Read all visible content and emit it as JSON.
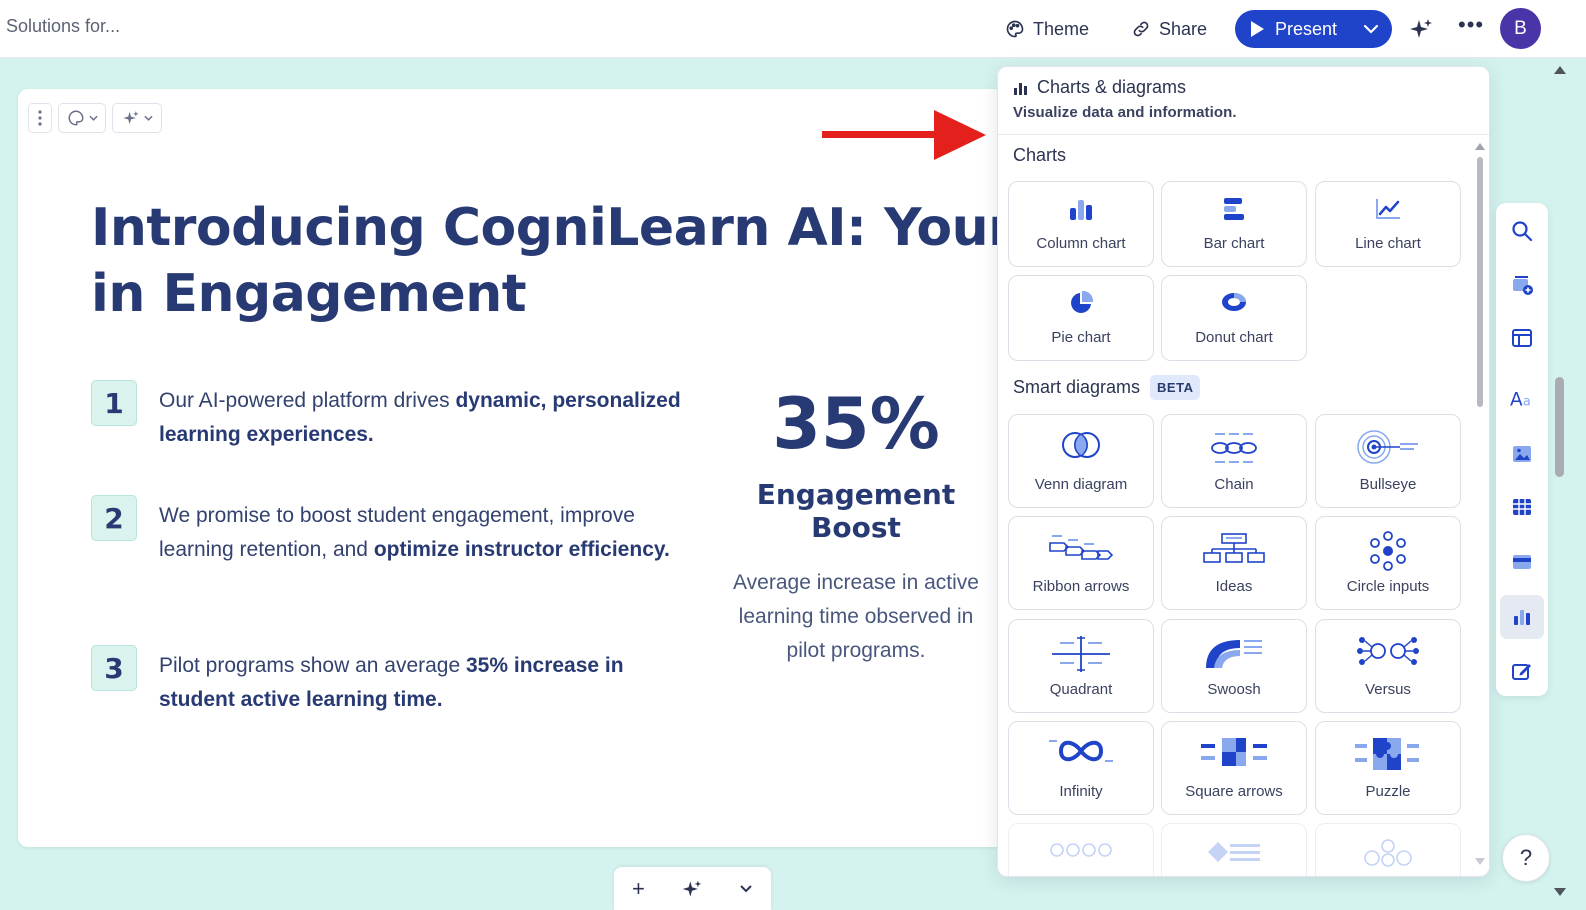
{
  "header": {
    "doc_title": "l Solutions for...",
    "theme_label": "Theme",
    "share_label": "Share",
    "present_label": "Present",
    "more_label": "•••",
    "avatar_initial": "B"
  },
  "slide": {
    "title": "Introducing CogniLearn AI: Your Partner in Engagement",
    "points": [
      {
        "number": "1",
        "text_before": "Our AI-powered platform drives ",
        "text_bold": "dynamic, personalized learning experiences.",
        "text_after": ""
      },
      {
        "number": "2",
        "text_before": "We promise to boost student engagement, improve learning retention, and ",
        "text_bold": "optimize instructor efficiency.",
        "text_after": ""
      },
      {
        "number": "3",
        "text_before": "Pilot programs show an average ",
        "text_bold": "35% increase in student active learning time.",
        "text_after": ""
      }
    ],
    "stat": {
      "value": "35%",
      "label": "Engagement Boost",
      "description": "Average increase in active learning time observed in pilot programs."
    }
  },
  "bottom_bar": {
    "add_label": "+"
  },
  "panel": {
    "title": "Charts & diagrams",
    "subtitle": "Visualize data and information.",
    "charts_heading": "Charts",
    "charts": [
      {
        "label": "Column chart",
        "icon": "column-chart-icon"
      },
      {
        "label": "Bar chart",
        "icon": "bar-chart-icon"
      },
      {
        "label": "Line chart",
        "icon": "line-chart-icon"
      },
      {
        "label": "Pie chart",
        "icon": "pie-chart-icon"
      },
      {
        "label": "Donut chart",
        "icon": "donut-chart-icon"
      }
    ],
    "diagrams_heading": "Smart diagrams",
    "beta_badge": "BETA",
    "diagrams": [
      {
        "label": "Venn diagram",
        "icon": "venn-diagram-icon"
      },
      {
        "label": "Chain",
        "icon": "chain-icon"
      },
      {
        "label": "Bullseye",
        "icon": "bullseye-icon"
      },
      {
        "label": "Ribbon arrows",
        "icon": "ribbon-arrows-icon"
      },
      {
        "label": "Ideas",
        "icon": "ideas-icon"
      },
      {
        "label": "Circle inputs",
        "icon": "circle-inputs-icon"
      },
      {
        "label": "Quadrant",
        "icon": "quadrant-icon"
      },
      {
        "label": "Swoosh",
        "icon": "swoosh-icon"
      },
      {
        "label": "Versus",
        "icon": "versus-icon"
      },
      {
        "label": "Infinity",
        "icon": "infinity-icon"
      },
      {
        "label": "Square arrows",
        "icon": "square-arrows-icon"
      },
      {
        "label": "Puzzle",
        "icon": "puzzle-icon"
      }
    ]
  },
  "help_label": "?",
  "colors": {
    "accent": "#1f44c9",
    "background": "#d4f3ee",
    "title_navy": "#283a73",
    "arrow_red": "#e3201b"
  }
}
